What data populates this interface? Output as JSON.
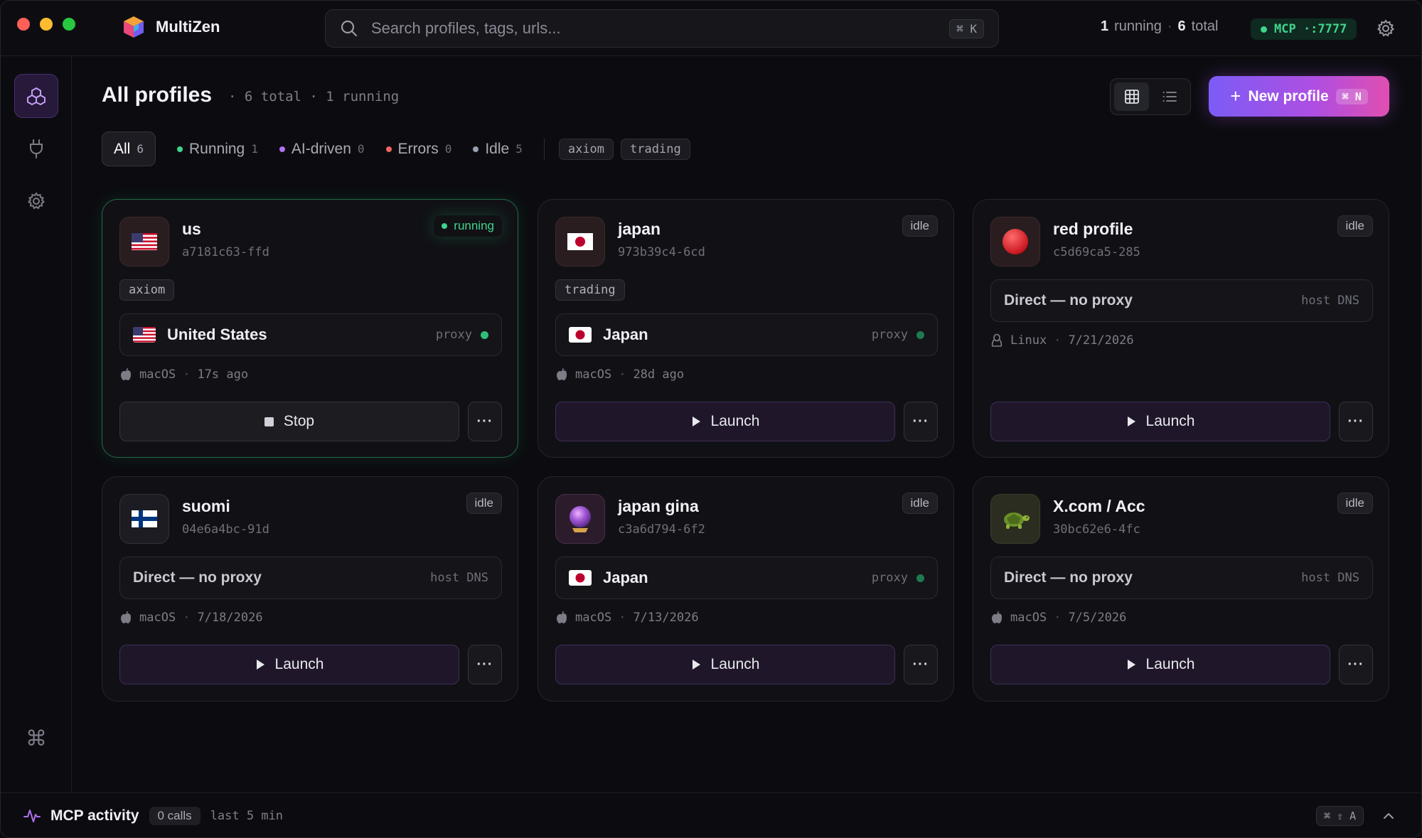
{
  "app": {
    "name": "MultiZen"
  },
  "search": {
    "placeholder": "Search profiles, tags, urls...",
    "shortcut": "⌘ K"
  },
  "top_stats": {
    "running_count": "1",
    "running_label": "running",
    "total_count": "6",
    "total_label": "total"
  },
  "mcp_badge": {
    "label": "MCP ·:7777",
    "color": "#3fd48c"
  },
  "header": {
    "title": "All profiles",
    "meta": "· 6 total · 1 running"
  },
  "new_profile": {
    "label": "New profile",
    "shortcut": "⌘ N"
  },
  "filters": [
    {
      "label": "All",
      "count": "6",
      "dot": ""
    },
    {
      "label": "Running",
      "count": "1",
      "dot": "#3fd48c"
    },
    {
      "label": "AI-driven",
      "count": "0",
      "dot": "#b072f0"
    },
    {
      "label": "Errors",
      "count": "0",
      "dot": "#f06262"
    },
    {
      "label": "Idle",
      "count": "5",
      "dot": "#9aa0b4"
    }
  ],
  "tag_filters": [
    "axiom",
    "trading"
  ],
  "profiles": [
    {
      "name": "us",
      "id": "a7181c63-ffd",
      "status": "running",
      "avatar": "flag-us",
      "tag": "axiom",
      "proxy_name": "United States",
      "proxy_flag": "flag-us",
      "proxy_kind": "proxy",
      "os": "macOS",
      "time": "17s ago",
      "action": "Stop",
      "more": "···"
    },
    {
      "name": "japan",
      "id": "973b39c4-6cd",
      "status": "idle",
      "avatar": "flag-jp",
      "tag": "trading",
      "proxy_name": "Japan",
      "proxy_flag": "flag-jp",
      "proxy_kind": "proxy",
      "os": "macOS",
      "time": "28d ago",
      "action": "Launch",
      "more": "···"
    },
    {
      "name": "red profile",
      "id": "c5d69ca5-285",
      "status": "idle",
      "avatar": "red-circle",
      "proxy_name": "Direct — no proxy",
      "proxy_kind": "host DNS",
      "os": "Linux",
      "time": "7/21/2026",
      "action": "Launch",
      "more": "···"
    },
    {
      "name": "suomi",
      "id": "04e6a4bc-91d",
      "status": "idle",
      "avatar": "flag-fi",
      "proxy_name": "Direct — no proxy",
      "proxy_kind": "host DNS",
      "os": "macOS",
      "time": "7/18/2026",
      "action": "Launch",
      "more": "···"
    },
    {
      "name": "japan gina",
      "id": "c3a6d794-6f2",
      "status": "idle",
      "avatar": "crystal-ball",
      "proxy_name": "Japan",
      "proxy_flag": "flag-jp",
      "proxy_kind": "proxy",
      "os": "macOS",
      "time": "7/13/2026",
      "action": "Launch",
      "more": "···"
    },
    {
      "name": "X.com / Acc",
      "id": "30bc62e6-4fc",
      "status": "idle",
      "avatar": "turtle",
      "proxy_name": "Direct — no proxy",
      "proxy_kind": "host DNS",
      "os": "macOS",
      "time": "7/5/2026",
      "action": "Launch",
      "more": "···"
    }
  ],
  "bottom": {
    "label": "MCP activity",
    "calls": "0 calls",
    "window": "last 5 min",
    "shortcut": "⌘ ⇧ A"
  }
}
